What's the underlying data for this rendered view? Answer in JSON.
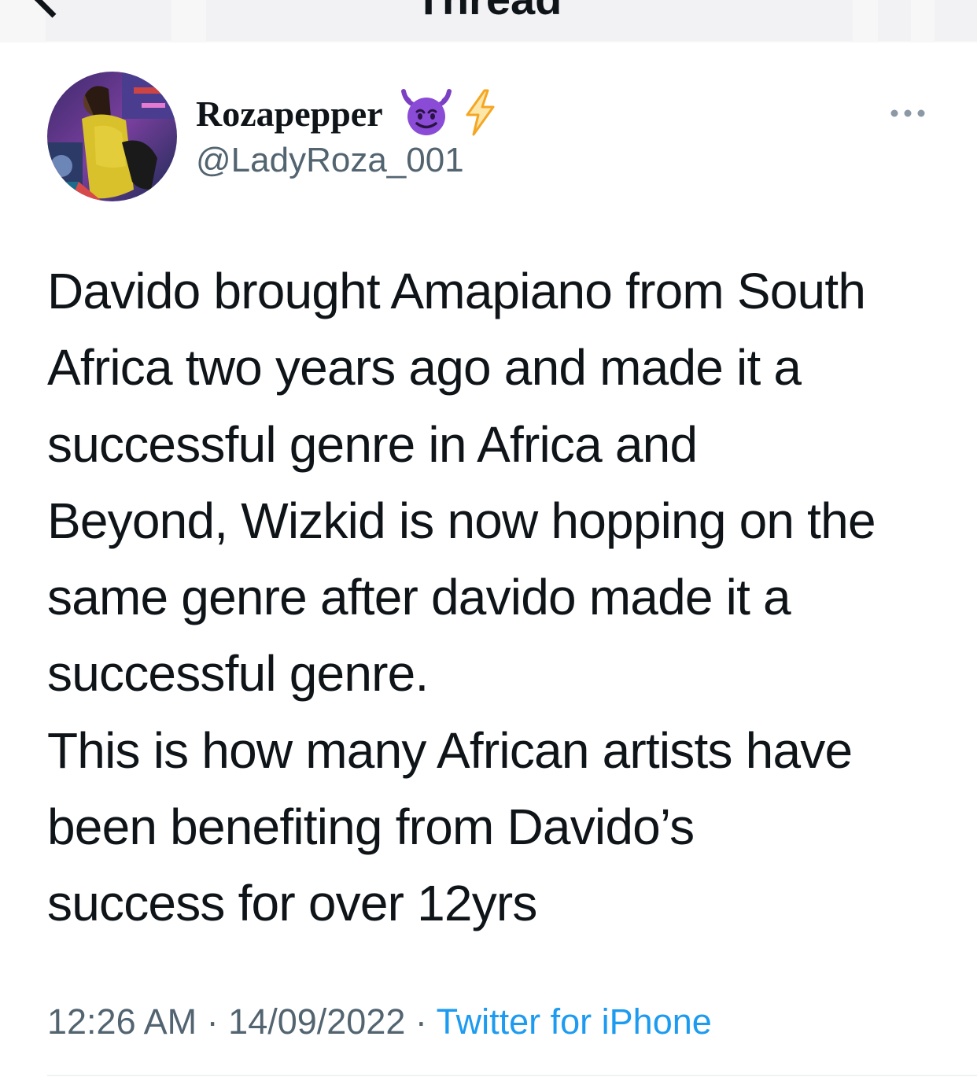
{
  "nav": {
    "title": "Thread",
    "back_icon": "chevron-left-icon"
  },
  "author": {
    "display_name": "Rozapepper",
    "emoji_1": "smiling-devil-icon",
    "emoji_2": "lightning-bolt-icon",
    "handle": "@LadyRoza_001"
  },
  "tweet": {
    "text": "Davido brought Amapiano from South\nAfrica two years ago and made it a\nsuccessful genre in Africa and\nBeyond, Wizkid is now hopping on the\nsame genre after davido made it a\nsuccessful genre.\nThis is how many African artists have\nbeen benefiting from Davido’s\nsuccess for over 12yrs",
    "time": "12:26 AM",
    "separator": "·",
    "date": "14/09/2022",
    "source": "Twitter for iPhone"
  },
  "colors": {
    "text": "#0f1419",
    "secondary": "#536471",
    "link": "#1d9bf0",
    "devil_purple": "#8a4bd6",
    "bolt_orange": "#f5a623"
  }
}
